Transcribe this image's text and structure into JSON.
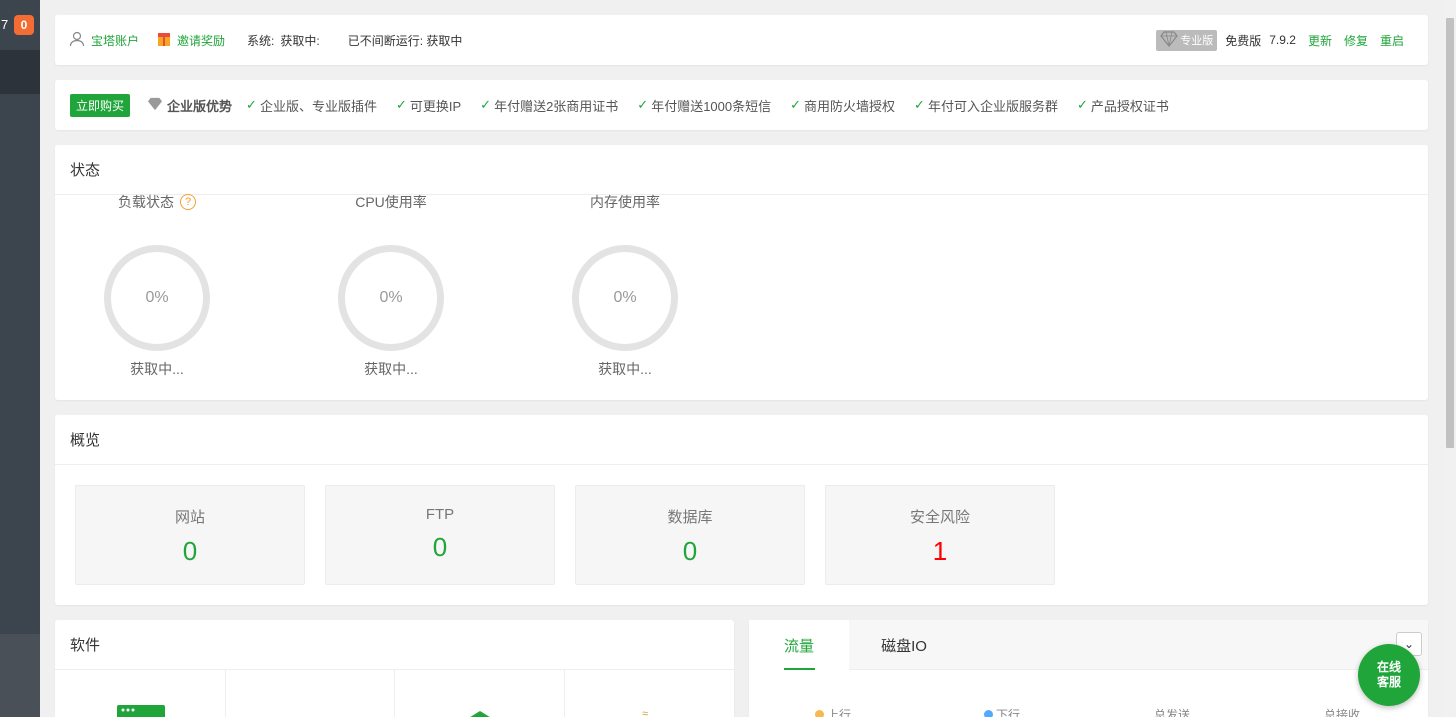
{
  "sidebar": {
    "count": "7",
    "badge": "0"
  },
  "topbar": {
    "account": "宝塔账户",
    "invite": "邀请奖励",
    "system_label": "系统:",
    "system_value": "获取中:",
    "uptime": "已不间断运行: 获取中",
    "pro_label": "专业版",
    "edition": "免费版",
    "version": "7.9.2",
    "update": "更新",
    "repair": "修复",
    "restart": "重启"
  },
  "promo": {
    "buy": "立即购买",
    "title": "企业版优势",
    "features": [
      "企业版、专业版插件",
      "可更换IP",
      "年付赠送2张商用证书",
      "年付赠送1000条短信",
      "商用防火墙授权",
      "年付可入企业版服务群",
      "产品授权证书"
    ]
  },
  "status": {
    "title": "状态",
    "gauges": [
      {
        "label": "负载状态",
        "value": "0%",
        "sub": "获取中..."
      },
      {
        "label": "CPU使用率",
        "value": "0%",
        "sub": "获取中..."
      },
      {
        "label": "内存使用率",
        "value": "0%",
        "sub": "获取中..."
      }
    ]
  },
  "overview": {
    "title": "概览",
    "cards": [
      {
        "label": "网站",
        "value": "0"
      },
      {
        "label": "FTP",
        "value": "0"
      },
      {
        "label": "数据库",
        "value": "0"
      },
      {
        "label": "安全风险",
        "value": "1"
      }
    ]
  },
  "software": {
    "title": "软件"
  },
  "traffic": {
    "tabs": [
      "流量",
      "磁盘IO"
    ],
    "legend": [
      "上行",
      "下行",
      "总发送",
      "总接收"
    ]
  },
  "chat": {
    "line1": "在线",
    "line2": "客服"
  },
  "colors": {
    "accent": "#20a53a",
    "danger": "#ff0000",
    "sidebar": "#3c444d",
    "badge": "#f26c33"
  }
}
